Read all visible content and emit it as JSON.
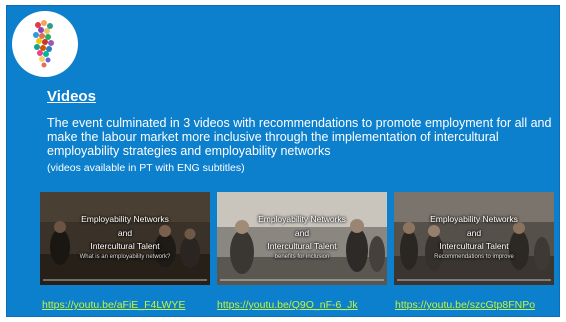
{
  "slide": {
    "title": "Videos",
    "body": "The event culminated in 3 videos with recommendations to promote employment for all and make the labour market more inclusive through the implementation of intercultural employability strategies and employability networks",
    "note": "(videos available in PT with ENG subtitles)"
  },
  "videos": [
    {
      "line1": "Employability Networks",
      "line2": "and",
      "line3": "Intercultural Talent",
      "line4": "What is an employability network?",
      "url": "https://youtu.be/aFiE_F4LWYE"
    },
    {
      "line1": "Employability Networks",
      "line2": "and",
      "line3": "Intercultural Talent",
      "line4": "benefits for inclusion",
      "url": "https://youtu.be/Q9O_nF-6_Jk"
    },
    {
      "line1": "Employability Networks",
      "line2": "and",
      "line3": "Intercultural Talent",
      "line4": "Recommendations to improve",
      "url": "https://youtu.be/szcGtp8FNPo"
    }
  ],
  "colors": {
    "background": "#0c7fcd",
    "text": "#ffffff",
    "link": "#c4f53a"
  },
  "icons": {
    "logo": "colorful-dots-logo-icon"
  }
}
